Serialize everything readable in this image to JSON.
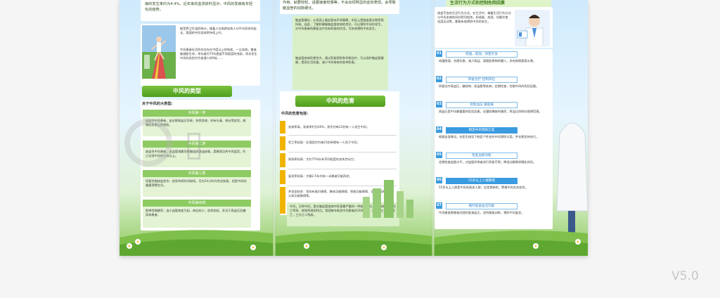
{
  "version_label": "V5.0",
  "colors": {
    "green": "#5aac25",
    "blue": "#3a9be0",
    "yellow": "#f0b400"
  },
  "panel1": {
    "intro_lines": [
      "病的发生率约为4.4%。近年来的监测资料显示，中风的发病有年轻化的趋势。"
    ],
    "photo_text": [
      "据世界卫生组织统计，随着人口老龄化和人口平均寿命的延长，我国的中风发病率持续上升。",
      "中风患者存活的往往存在中度以上的残疾，一旦发病，重者能威胁生命，幸存者约75%遗留不同程度的残疾，再次发生中风的风险约为普通人的9倍……"
    ],
    "section_title": "中风的类型",
    "types_intro": "关于中风的大类型:",
    "types": [
      {
        "title": "中风第一类",
        "lines": [
          "出血性中风患者，由长期高血压导致，突然发病，伴有头痛、呕吐等症状，病情危急需立即就医。"
        ]
      },
      {
        "title": "中风第二类",
        "lines": [
          "缺血性中风患者，由血管堵塞导致脑组织缺血缺氧，是最常见的中风类型，约占全部中风的七成以上。"
        ]
      },
      {
        "title": "中风第三类",
        "lines": [
          "短暂性脑缺血发作，症状持续时间较短，可在24小时内完全恢复，但是中风的重要预警信号。"
        ]
      },
      {
        "title": "中风第四类",
        "lines": [
          "腔隙性脑梗死，由小血管病变引起，病灶较小，症状较轻，多见于高血压及糖尿病患者。"
        ]
      }
    ]
  },
  "panel2": {
    "top_text": [
      "作用，就要较轻，进展速度较慢等，不会出现明显的症状表现。会导致脑血管的动脉硬化。"
    ],
    "box_text": [
      "脑血管硬化，从表面上看血管似乎很健康，实际上是脑血管长期受损所致。因此，了解和掌握脑血管疾病的常识，可以预防中风的发生，对中风患者的康复治疗也有积极的作用，可有效预防中风发生。",
      "脑血管疾病危害性大，通过积极预防和早期治疗，可以保护脑血管健康，提高生活质量，减少中风带来的各种危害。"
    ],
    "section_title": "中风的危害",
    "harms_intro": "中风的危害包括：",
    "harms": [
      "发病率高，发病率约为26%，即大约每12秒有一人发生中风；",
      "死亡率较高：在我国大约每21秒钟就有一人死于中风；",
      "致残率较高：大约75%存有不同程度的丧失劳动力；",
      "复发率较高：大概2-5年内有一半患者可能再发；",
      "并发症较多：常伴有意识障碍、肢体功能障碍、吞咽功能障碍、言语功能障碍、认知功能障碍等。"
    ],
    "bottom_text": [
      "中风，又称中风，是在脑血管疾病中危害最严重的一种疾病，它具有发病率高、死亡率高、致残率高的特点。我国每年新发中风患者约200万人，其中约三分之一死亡，三分之二残疾。"
    ]
  },
  "panel3": {
    "header_text": "生活行为方式和控制危险因素",
    "doctor_text": [
      "改变不良的生活行为方式，在生活中，掌握生活行为方式与中风发病的风险密切相关。如戒烟、戒酒、均衡饮食、适度运动等，都能有效预防中风的发生。"
    ],
    "items": [
      {
        "num": "01",
        "title": "戒烟、戒酒、改变饮食",
        "lines": [
          "戒烟限酒，合理饮食，减少高盐、高脂肪食物的摄入，多吃新鲜蔬菜水果。"
        ]
      },
      {
        "num": "02",
        "title": "积极治疗 控制风险",
        "lines": [
          "积极治疗高血压、糖尿病、高血脂等疾病，定期检查，控制中风的危险因素。"
        ]
      },
      {
        "num": "03",
        "title": "控制血压 遵医嘱",
        "lines": [
          "高血压是中风最重要的危险因素，应遵医嘱按时服药，将血压控制在理想范围。"
        ]
      },
      {
        "num": "04",
        "title": "制定中风预防方案",
        "lines": [
          "根据自身情况，在医生指导下制定个性化的中风预防方案，并长期坚持执行。"
        ]
      },
      {
        "num": "05",
        "title": "检查血脂功能",
        "lines": [
          "定期检查血脂水平，对血脂异常者进行积极干预，降低动脉粥样硬化风险。"
        ]
      },
      {
        "num": "06",
        "title": "55岁以上人群警惕",
        "lines": [
          "55岁以上人群是中风的高发人群，应定期体检，警惕中风先兆症状。"
        ]
      },
      {
        "num": "07",
        "title": "随时复查血压功能",
        "lines": [
          "中风康复期患者应随时复查血压，坚持康复训练，预防中风复发。"
        ]
      }
    ]
  }
}
